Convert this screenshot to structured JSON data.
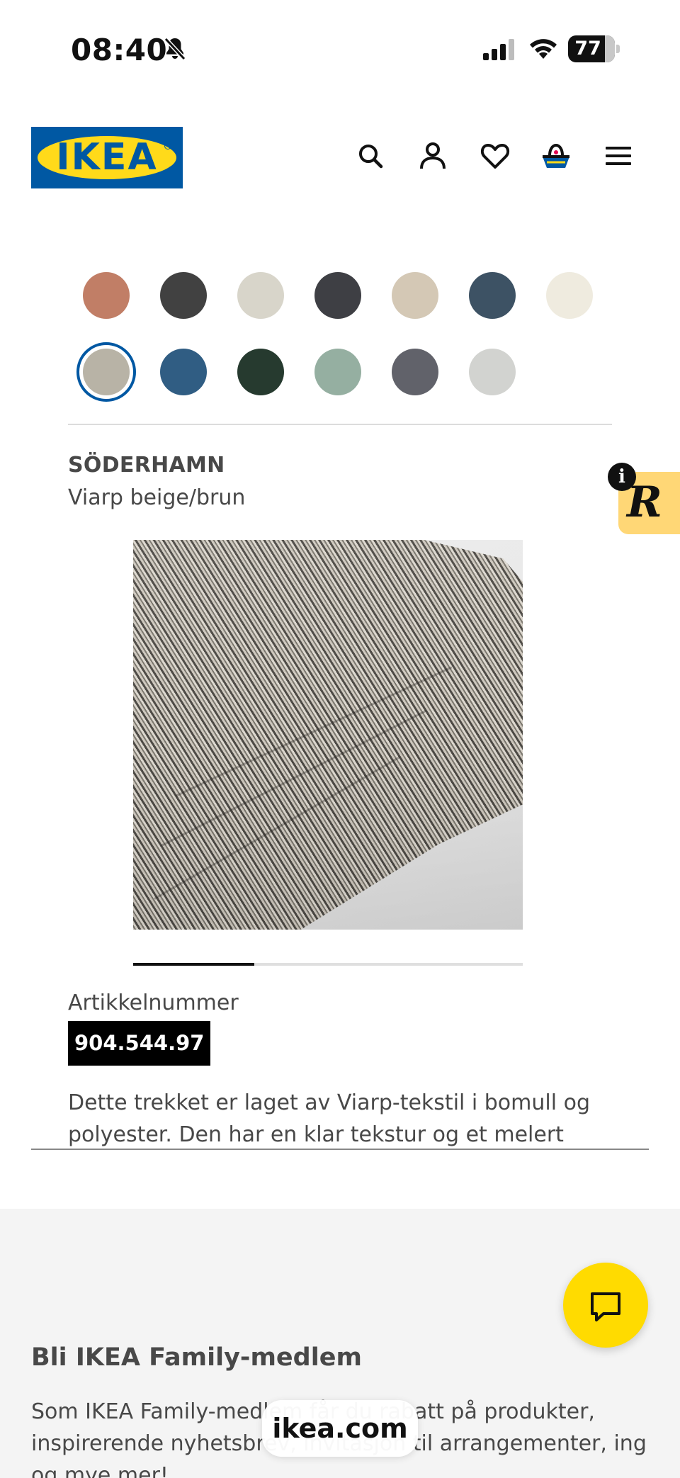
{
  "status_bar": {
    "time": "08:40",
    "battery": "77",
    "icons": [
      "bell-slash-icon",
      "signal-icon",
      "wifi-icon",
      "battery-icon"
    ]
  },
  "header": {
    "logo_text": "IKEA",
    "brand_colors": {
      "blue": "#0058a3",
      "yellow": "#ffda1a"
    },
    "icons": [
      "search-icon",
      "account-icon",
      "heart-icon",
      "cart-icon",
      "menu-icon"
    ]
  },
  "swatches": [
    {
      "color": "#c17e66",
      "selected": false
    },
    {
      "color": "#414141",
      "selected": false
    },
    {
      "color": "#d8d5ca",
      "selected": false
    },
    {
      "color": "#3e3f44",
      "selected": false
    },
    {
      "color": "#d4c8b5",
      "selected": false
    },
    {
      "color": "#3d5264",
      "selected": false
    },
    {
      "color": "#efebdf",
      "selected": false
    },
    {
      "color": "#b8b3a6",
      "selected": true
    },
    {
      "color": "#305d83",
      "selected": false
    },
    {
      "color": "#263a2f",
      "selected": false
    },
    {
      "color": "#95afa1",
      "selected": false
    },
    {
      "color": "#61626a",
      "selected": false
    },
    {
      "color": "#d2d3d0",
      "selected": false
    }
  ],
  "product": {
    "name": "SÖDERHAMN",
    "variant": "Viarp beige/brun",
    "image_progress_fraction": 0.31,
    "article_label": "Artikkelnummer",
    "article_number": "904.544.97",
    "description": "Dette trekket er laget av Viarp-tekstil i bomull og polyester. Den har en klar tekstur og et melert"
  },
  "badge": {
    "letter": "R",
    "info": "i"
  },
  "family": {
    "title": "Bli IKEA Family-medlem",
    "text": "Som IKEA Family-medlem får du rabatt på produkter, inspirerende nyhetsbrev, invitasjon til arrangementer, ing og mye mer!"
  },
  "browser": {
    "url": "ikea.com"
  },
  "chat": {
    "icon": "chat-icon"
  }
}
